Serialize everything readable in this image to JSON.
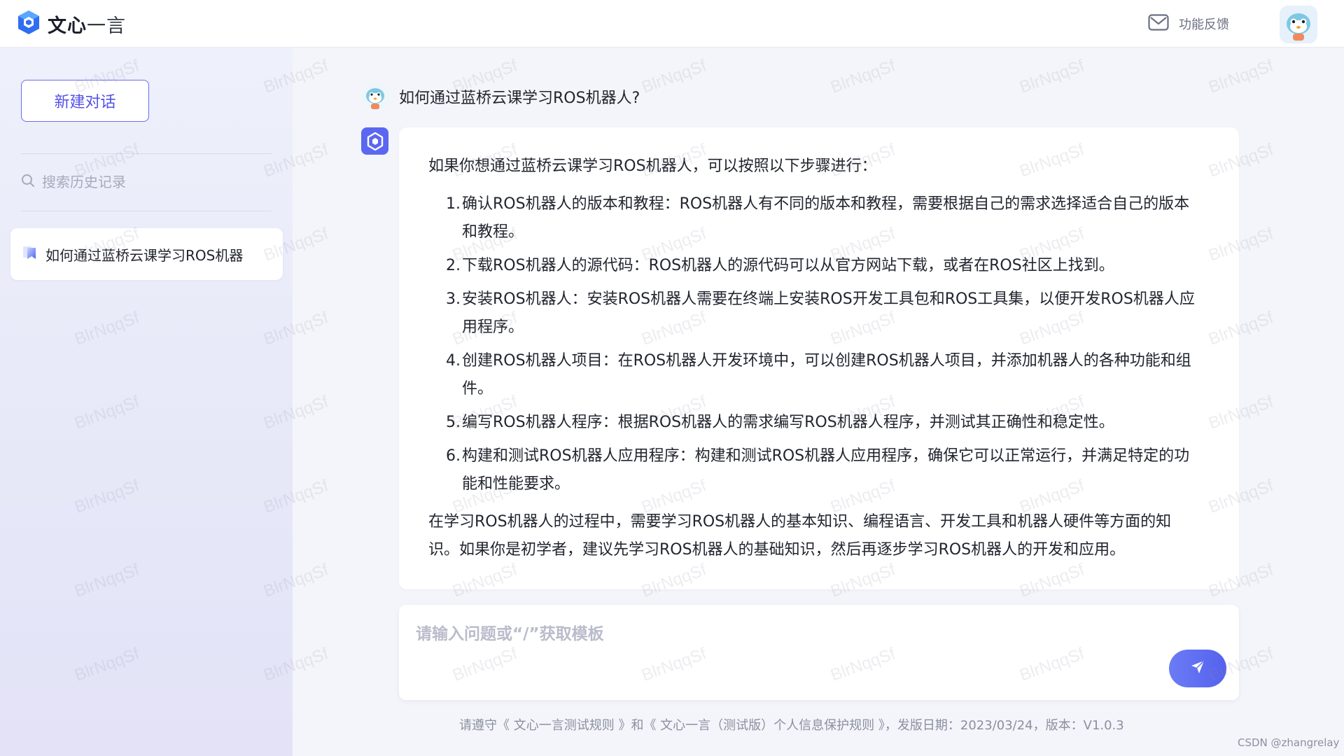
{
  "header": {
    "brand_name_bold": "文心",
    "brand_name_light": "一言",
    "feedback_label": "功能反馈"
  },
  "sidebar": {
    "new_chat_label": "新建对话",
    "search_placeholder": "搜索历史记录",
    "history": [
      {
        "label": "如何通过蓝桥云课学习ROS机器"
      }
    ]
  },
  "conversation": {
    "question": "如何通过蓝桥云课学习ROS机器人?",
    "answer": {
      "intro": "如果你想通过蓝桥云课学习ROS机器人，可以按照以下步骤进行：",
      "steps": [
        {
          "num": "1.",
          "text": "确认ROS机器人的版本和教程：ROS机器人有不同的版本和教程，需要根据自己的需求选择适合自己的版本和教程。"
        },
        {
          "num": "2.",
          "text": "下载ROS机器人的源代码：ROS机器人的源代码可以从官方网站下载，或者在ROS社区上找到。"
        },
        {
          "num": "3.",
          "text": "安装ROS机器人：安装ROS机器人需要在终端上安装ROS开发工具包和ROS工具集，以便开发ROS机器人应用程序。"
        },
        {
          "num": "4.",
          "text": "创建ROS机器人项目：在ROS机器人开发环境中，可以创建ROS机器人项目，并添加机器人的各种功能和组件。"
        },
        {
          "num": "5.",
          "text": "编写ROS机器人程序：根据ROS机器人的需求编写ROS机器人程序，并测试其正确性和稳定性。"
        },
        {
          "num": "6.",
          "text": "构建和测试ROS机器人应用程序：构建和测试ROS机器人应用程序，确保它可以正常运行，并满足特定的功能和性能要求。"
        }
      ],
      "outro": "在学习ROS机器人的过程中，需要学习ROS机器人的基本知识、编程语言、开发工具和机器人硬件等方面的知识。如果你是初学者，建议先学习ROS机器人的基础知识，然后再逐步学习ROS机器人的开发和应用。"
    }
  },
  "input": {
    "placeholder": "请输入问题或“/”获取模板"
  },
  "footer": {
    "note": "请遵守《 文心一言测试规则 》和《 文心一言（测试版）个人信息保护规则 》，发版日期：2023/03/24，版本：V1.0.3",
    "credit": "CSDN @zhangrelay"
  },
  "watermark": {
    "text": "BlrNqqSf"
  },
  "colors": {
    "accent": "#5b67f0",
    "sidebar_bg": "#e8eaf8",
    "text": "#22252f"
  },
  "icons": {
    "brand": "logo-cube-icon",
    "feedback": "mail-icon",
    "search": "search-icon",
    "history": "chat-bookmark-icon",
    "send": "send-icon"
  }
}
